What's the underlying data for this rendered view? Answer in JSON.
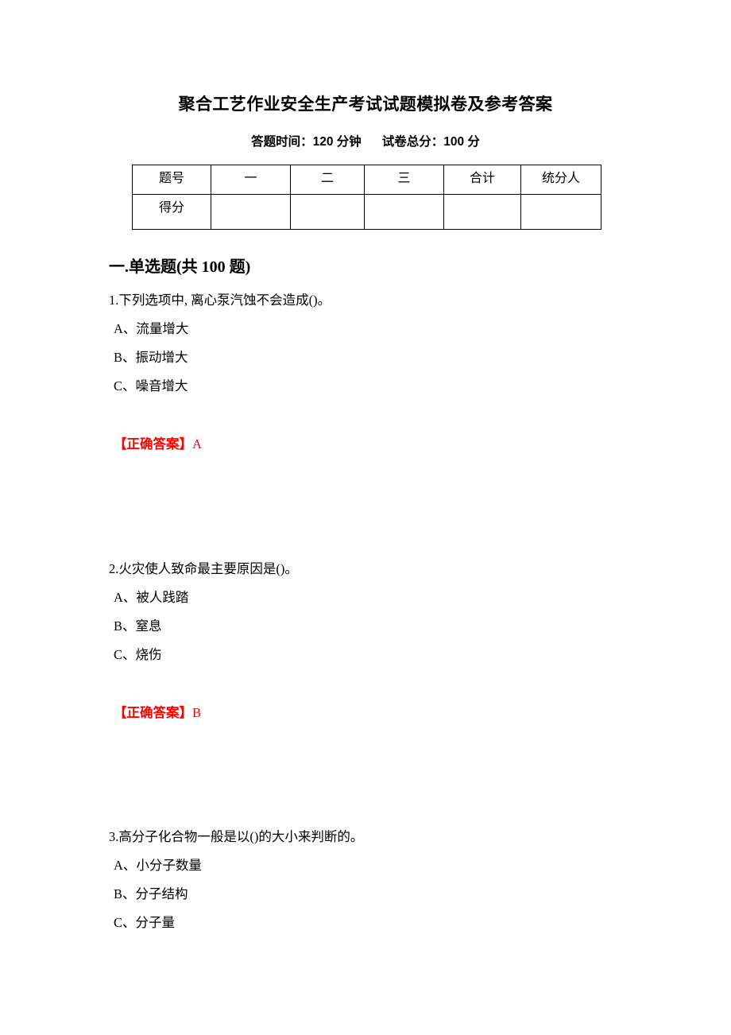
{
  "document": {
    "title": "聚合工艺作业安全生产考试试题模拟卷及参考答案",
    "subtitle_time": "答题时间：120 分钟",
    "subtitle_score": "试卷总分：100 分",
    "answer_color": "#ff0000"
  },
  "score_table": {
    "headers": [
      "题号",
      "一",
      "二",
      "三",
      "合计",
      "统分人"
    ],
    "rows": [
      {
        "label": "得分",
        "cells": [
          "",
          "",
          "",
          "",
          ""
        ]
      }
    ]
  },
  "sections": [
    {
      "heading": "一.单选题(共 100 题)",
      "questions": [
        {
          "stem": "1.下列选项中, 离心泵汽蚀不会造成()。",
          "options": [
            "A、流量增大",
            "B、振动增大",
            "C、噪音增大"
          ],
          "answer_tag": "【正确答案】",
          "answer_letter": "A"
        },
        {
          "stem": "2.火灾使人致命最主要原因是()。",
          "options": [
            "A、被人践踏",
            "B、窒息",
            "C、烧伤"
          ],
          "answer_tag": "【正确答案】",
          "answer_letter": "B"
        },
        {
          "stem": "3.高分子化合物一般是以()的大小来判断的。",
          "options": [
            "A、小分子数量",
            "B、分子结构",
            "C、分子量"
          ],
          "answer_tag": "",
          "answer_letter": ""
        }
      ]
    }
  ]
}
